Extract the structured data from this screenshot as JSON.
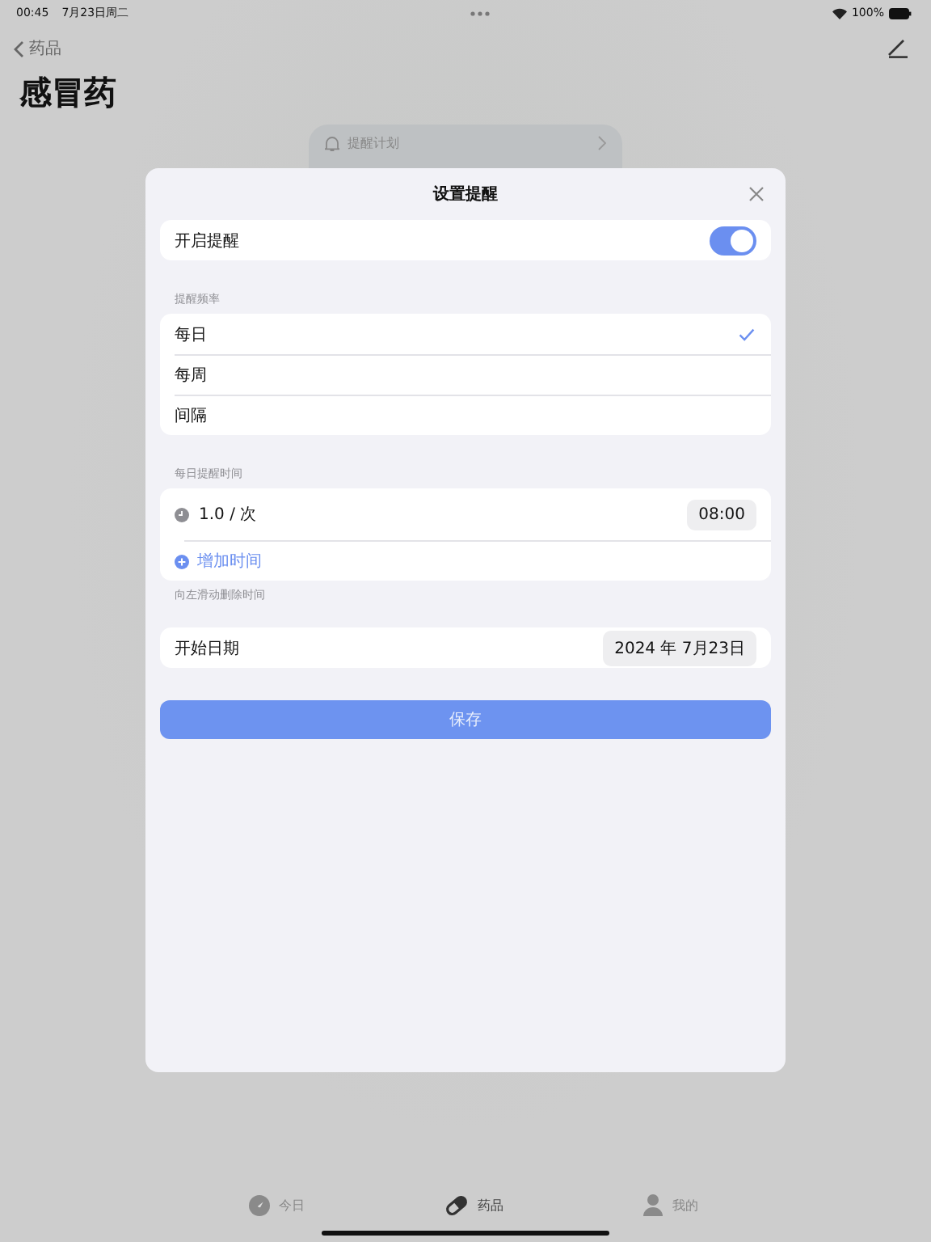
{
  "status_bar": {
    "time": "00:45",
    "date": "7月23日周二",
    "battery": "100%"
  },
  "nav": {
    "back_label": "药品",
    "title": "感冒药"
  },
  "background_card": {
    "title": "提醒计划"
  },
  "modal": {
    "title": "设置提醒",
    "enable": {
      "label": "开启提醒",
      "on": true
    },
    "frequency": {
      "label": "提醒频率",
      "options": [
        {
          "label": "每日",
          "selected": true
        },
        {
          "label": "每周",
          "selected": false
        },
        {
          "label": "间隔",
          "selected": false
        }
      ]
    },
    "times": {
      "label": "每日提醒时间",
      "entries": [
        {
          "dose": "1.0 / 次",
          "time": "08:00"
        }
      ],
      "add_label": "增加时间",
      "hint": "向左滑动删除时间"
    },
    "start_date": {
      "label": "开始日期",
      "value": "2024 年 7月23日"
    },
    "save_label": "保存"
  },
  "tab_bar": [
    {
      "kind": "today",
      "label": "今日",
      "selected": false
    },
    {
      "kind": "medicine",
      "label": "药品",
      "selected": true
    },
    {
      "kind": "profile",
      "label": "我的",
      "selected": false
    }
  ]
}
